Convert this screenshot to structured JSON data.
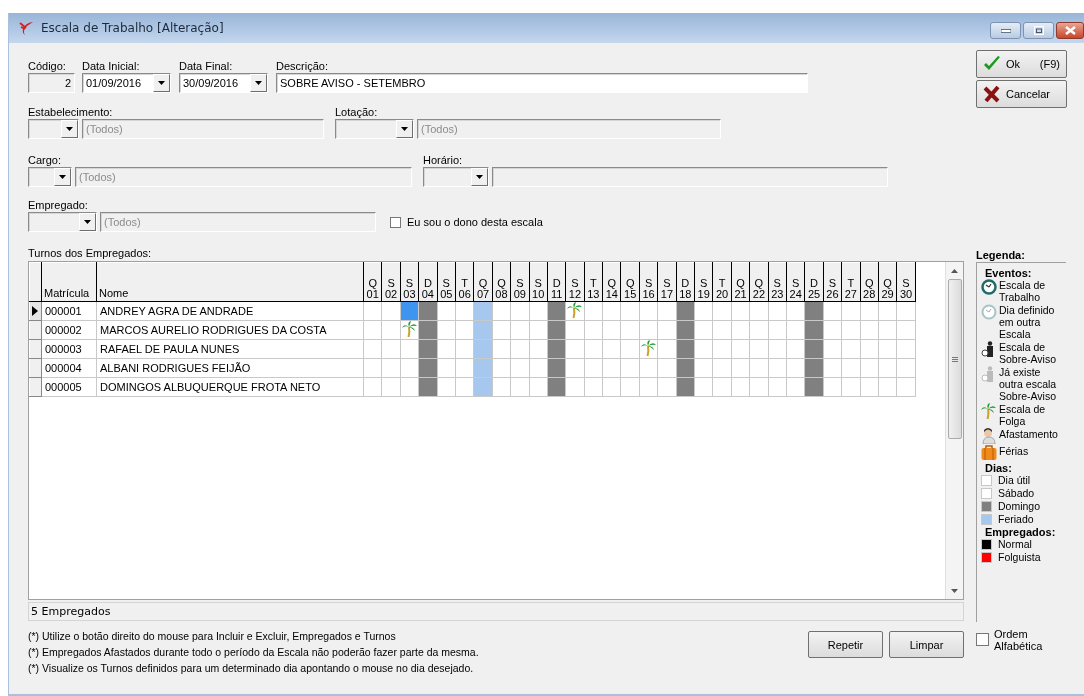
{
  "window": {
    "title": "Escala de Trabalho [Alteração]"
  },
  "header": [
    {
      "kind": "number",
      "label": "Código:",
      "value": "2"
    },
    {
      "kind": "date",
      "label": "Data Inicial:",
      "value": "01/09/2016"
    },
    {
      "kind": "date",
      "label": "Data Final:",
      "value": "30/09/2016"
    },
    {
      "kind": "text",
      "label": "Descrição:",
      "value": "SOBRE AVISO - SETEMBRO"
    }
  ],
  "filters": [
    {
      "label": "Estabelecimento:",
      "text": "(Todos)"
    },
    {
      "label": "Lotação:",
      "text": "(Todos)"
    },
    {
      "label": "Cargo:",
      "text": "(Todos)"
    },
    {
      "label": "Horário:"
    },
    {
      "label": "Empregado:",
      "text": "(Todos)"
    }
  ],
  "owner_checkbox": {
    "label": "Eu sou o dono desta escala",
    "checked": false
  },
  "actions": [
    {
      "kind": "ok",
      "label": "Ok",
      "shortcut": "(F9)"
    },
    {
      "kind": "cancel",
      "label": "Cancelar"
    }
  ],
  "grid": {
    "title": "Turnos dos Empregados:",
    "columns": [
      "Matrícula",
      "Nome"
    ],
    "days": [
      {
        "weekday": "Q",
        "day": "01",
        "kind": "util"
      },
      {
        "weekday": "S",
        "day": "02",
        "kind": "util"
      },
      {
        "weekday": "S",
        "day": "03",
        "kind": "sabado"
      },
      {
        "weekday": "D",
        "day": "04",
        "kind": "domingo"
      },
      {
        "weekday": "S",
        "day": "05",
        "kind": "util"
      },
      {
        "weekday": "T",
        "day": "06",
        "kind": "util"
      },
      {
        "weekday": "Q",
        "day": "07",
        "kind": "feriado"
      },
      {
        "weekday": "Q",
        "day": "08",
        "kind": "util"
      },
      {
        "weekday": "S",
        "day": "09",
        "kind": "util"
      },
      {
        "weekday": "S",
        "day": "10",
        "kind": "sabado"
      },
      {
        "weekday": "D",
        "day": "11",
        "kind": "domingo"
      },
      {
        "weekday": "S",
        "day": "12",
        "kind": "util"
      },
      {
        "weekday": "T",
        "day": "13",
        "kind": "util"
      },
      {
        "weekday": "Q",
        "day": "14",
        "kind": "util"
      },
      {
        "weekday": "Q",
        "day": "15",
        "kind": "util"
      },
      {
        "weekday": "S",
        "day": "16",
        "kind": "util"
      },
      {
        "weekday": "S",
        "day": "17",
        "kind": "sabado"
      },
      {
        "weekday": "D",
        "day": "18",
        "kind": "domingo"
      },
      {
        "weekday": "S",
        "day": "19",
        "kind": "util"
      },
      {
        "weekday": "T",
        "day": "20",
        "kind": "util"
      },
      {
        "weekday": "Q",
        "day": "21",
        "kind": "util"
      },
      {
        "weekday": "Q",
        "day": "22",
        "kind": "util"
      },
      {
        "weekday": "S",
        "day": "23",
        "kind": "util"
      },
      {
        "weekday": "S",
        "day": "24",
        "kind": "sabado"
      },
      {
        "weekday": "D",
        "day": "25",
        "kind": "domingo"
      },
      {
        "weekday": "S",
        "day": "26",
        "kind": "util"
      },
      {
        "weekday": "T",
        "day": "27",
        "kind": "util"
      },
      {
        "weekday": "Q",
        "day": "28",
        "kind": "util"
      },
      {
        "weekday": "Q",
        "day": "29",
        "kind": "util"
      },
      {
        "weekday": "S",
        "day": "30",
        "kind": "util"
      }
    ],
    "rows": [
      {
        "matricula": "000001",
        "nome": "ANDREY AGRA DE ANDRADE",
        "current": true,
        "cells": [
          {
            "selected": false
          },
          {
            "selected": false
          },
          {
            "selected": true
          },
          {
            "selected": false
          },
          {
            "selected": false
          },
          {
            "selected": false
          },
          {
            "selected": false
          },
          {
            "selected": false
          },
          {
            "selected": false
          },
          {
            "selected": false
          },
          {
            "selected": false
          },
          {
            "selected": false,
            "kind": "folga"
          },
          {
            "selected": false
          },
          {
            "selected": false
          },
          {
            "selected": false
          },
          {
            "selected": false
          },
          {
            "selected": false
          },
          {
            "selected": false
          },
          {
            "selected": false
          },
          {
            "selected": false
          },
          {
            "selected": false
          },
          {
            "selected": false
          },
          {
            "selected": false
          },
          {
            "selected": false
          },
          {
            "selected": false
          },
          {
            "selected": false
          },
          {
            "selected": false
          },
          {
            "selected": false
          },
          {
            "selected": false
          },
          {
            "selected": false
          }
        ]
      },
      {
        "matricula": "000002",
        "nome": "MARCOS AURELIO RODRIGUES DA COSTA",
        "current": false,
        "cells": [
          {
            "selected": false
          },
          {
            "selected": false
          },
          {
            "selected": false,
            "kind": "folga"
          },
          {
            "selected": false
          },
          {
            "selected": false
          },
          {
            "selected": false
          },
          {
            "selected": false
          },
          {
            "selected": false
          },
          {
            "selected": false
          },
          {
            "selected": false
          },
          {
            "selected": false
          },
          {
            "selected": false
          },
          {
            "selected": false
          },
          {
            "selected": false
          },
          {
            "selected": false
          },
          {
            "selected": false
          },
          {
            "selected": false
          },
          {
            "selected": false
          },
          {
            "selected": false
          },
          {
            "selected": false
          },
          {
            "selected": false
          },
          {
            "selected": false
          },
          {
            "selected": false
          },
          {
            "selected": false
          },
          {
            "selected": false
          },
          {
            "selected": false
          },
          {
            "selected": false
          },
          {
            "selected": false
          },
          {
            "selected": false
          },
          {
            "selected": false
          }
        ]
      },
      {
        "matricula": "000003",
        "nome": "RAFAEL DE PAULA NUNES",
        "current": false,
        "cells": [
          {
            "selected": false
          },
          {
            "selected": false
          },
          {
            "selected": false
          },
          {
            "selected": false
          },
          {
            "selected": false
          },
          {
            "selected": false
          },
          {
            "selected": false
          },
          {
            "selected": false
          },
          {
            "selected": false
          },
          {
            "selected": false
          },
          {
            "selected": false
          },
          {
            "selected": false
          },
          {
            "selected": false
          },
          {
            "selected": false
          },
          {
            "selected": false
          },
          {
            "selected": false,
            "kind": "folga"
          },
          {
            "selected": false
          },
          {
            "selected": false
          },
          {
            "selected": false
          },
          {
            "selected": false
          },
          {
            "selected": false
          },
          {
            "selected": false
          },
          {
            "selected": false
          },
          {
            "selected": false
          },
          {
            "selected": false
          },
          {
            "selected": false
          },
          {
            "selected": false
          },
          {
            "selected": false
          },
          {
            "selected": false
          },
          {
            "selected": false
          }
        ]
      },
      {
        "matricula": "000004",
        "nome": "ALBANI RODRIGUES FEIJÃO",
        "current": false,
        "cells": [
          {
            "selected": false
          },
          {
            "selected": false
          },
          {
            "selected": false
          },
          {
            "selected": false
          },
          {
            "selected": false
          },
          {
            "selected": false
          },
          {
            "selected": false
          },
          {
            "selected": false
          },
          {
            "selected": false
          },
          {
            "selected": false
          },
          {
            "selected": false
          },
          {
            "selected": false
          },
          {
            "selected": false
          },
          {
            "selected": false
          },
          {
            "selected": false
          },
          {
            "selected": false
          },
          {
            "selected": false
          },
          {
            "selected": false
          },
          {
            "selected": false
          },
          {
            "selected": false
          },
          {
            "selected": false
          },
          {
            "selected": false
          },
          {
            "selected": false
          },
          {
            "selected": false
          },
          {
            "selected": false
          },
          {
            "selected": false
          },
          {
            "selected": false
          },
          {
            "selected": false
          },
          {
            "selected": false
          },
          {
            "selected": false
          }
        ]
      },
      {
        "matricula": "000005",
        "nome": "DOMINGOS ALBUQUERQUE FROTA NETO",
        "current": false,
        "cells": [
          {
            "selected": false
          },
          {
            "selected": false
          },
          {
            "selected": false
          },
          {
            "selected": false
          },
          {
            "selected": false
          },
          {
            "selected": false
          },
          {
            "selected": false
          },
          {
            "selected": false
          },
          {
            "selected": false
          },
          {
            "selected": false
          },
          {
            "selected": false
          },
          {
            "selected": false
          },
          {
            "selected": false
          },
          {
            "selected": false
          },
          {
            "selected": false
          },
          {
            "selected": false
          },
          {
            "selected": false
          },
          {
            "selected": false
          },
          {
            "selected": false
          },
          {
            "selected": false
          },
          {
            "selected": false
          },
          {
            "selected": false
          },
          {
            "selected": false
          },
          {
            "selected": false
          },
          {
            "selected": false
          },
          {
            "selected": false
          },
          {
            "selected": false
          },
          {
            "selected": false
          },
          {
            "selected": false
          },
          {
            "selected": false
          }
        ]
      }
    ]
  },
  "count": "5 Empregados",
  "notes": [
    "(*) Utilize o botão direito do mouse para Incluir e Excluir, Empregados e Turnos",
    "(*) Empregados Afastados durante todo o período da Escala não poderão fazer parte da mesma.",
    "(*) Visualize os Turnos definidos para um determinado dia apontando o mouse no dia desejado."
  ],
  "grid_buttons": [
    "Repetir",
    "Limpar"
  ],
  "legend": {
    "title": "Legenda:",
    "sections": [
      {
        "heading": "Eventos:",
        "items": [
          {
            "kind": "clock",
            "label": "Escala de Trabalho"
          },
          {
            "kind": "clock-faded",
            "label": "Dia definido em outra Escala"
          },
          {
            "kind": "person",
            "label": "Escala de Sobre-Aviso"
          },
          {
            "kind": "person-faded",
            "label": "Já existe outra escala Sobre-Aviso"
          },
          {
            "kind": "palm",
            "label": "Escala de Folga"
          },
          {
            "kind": "sick",
            "label": "Afastamento"
          },
          {
            "kind": "suitcase",
            "label": "Férias"
          }
        ]
      },
      {
        "heading": "Dias:",
        "items": [
          {
            "kind": "swatch",
            "label": "Dia útil",
            "color": "#ffffff"
          },
          {
            "kind": "swatch",
            "label": "Sábado",
            "color": "#ffffff"
          },
          {
            "kind": "swatch",
            "label": "Domingo",
            "color": "#808080"
          },
          {
            "kind": "swatch",
            "label": "Feriado",
            "color": "#a6c8ee"
          }
        ]
      },
      {
        "heading": "Empregados:",
        "items": [
          {
            "kind": "swatch",
            "label": "Normal",
            "color": "#000000"
          },
          {
            "kind": "swatch",
            "label": "Folguista",
            "color": "#ff0000"
          }
        ]
      }
    ],
    "order_checkbox": {
      "label": "Ordem Alfabética",
      "checked": false
    }
  }
}
